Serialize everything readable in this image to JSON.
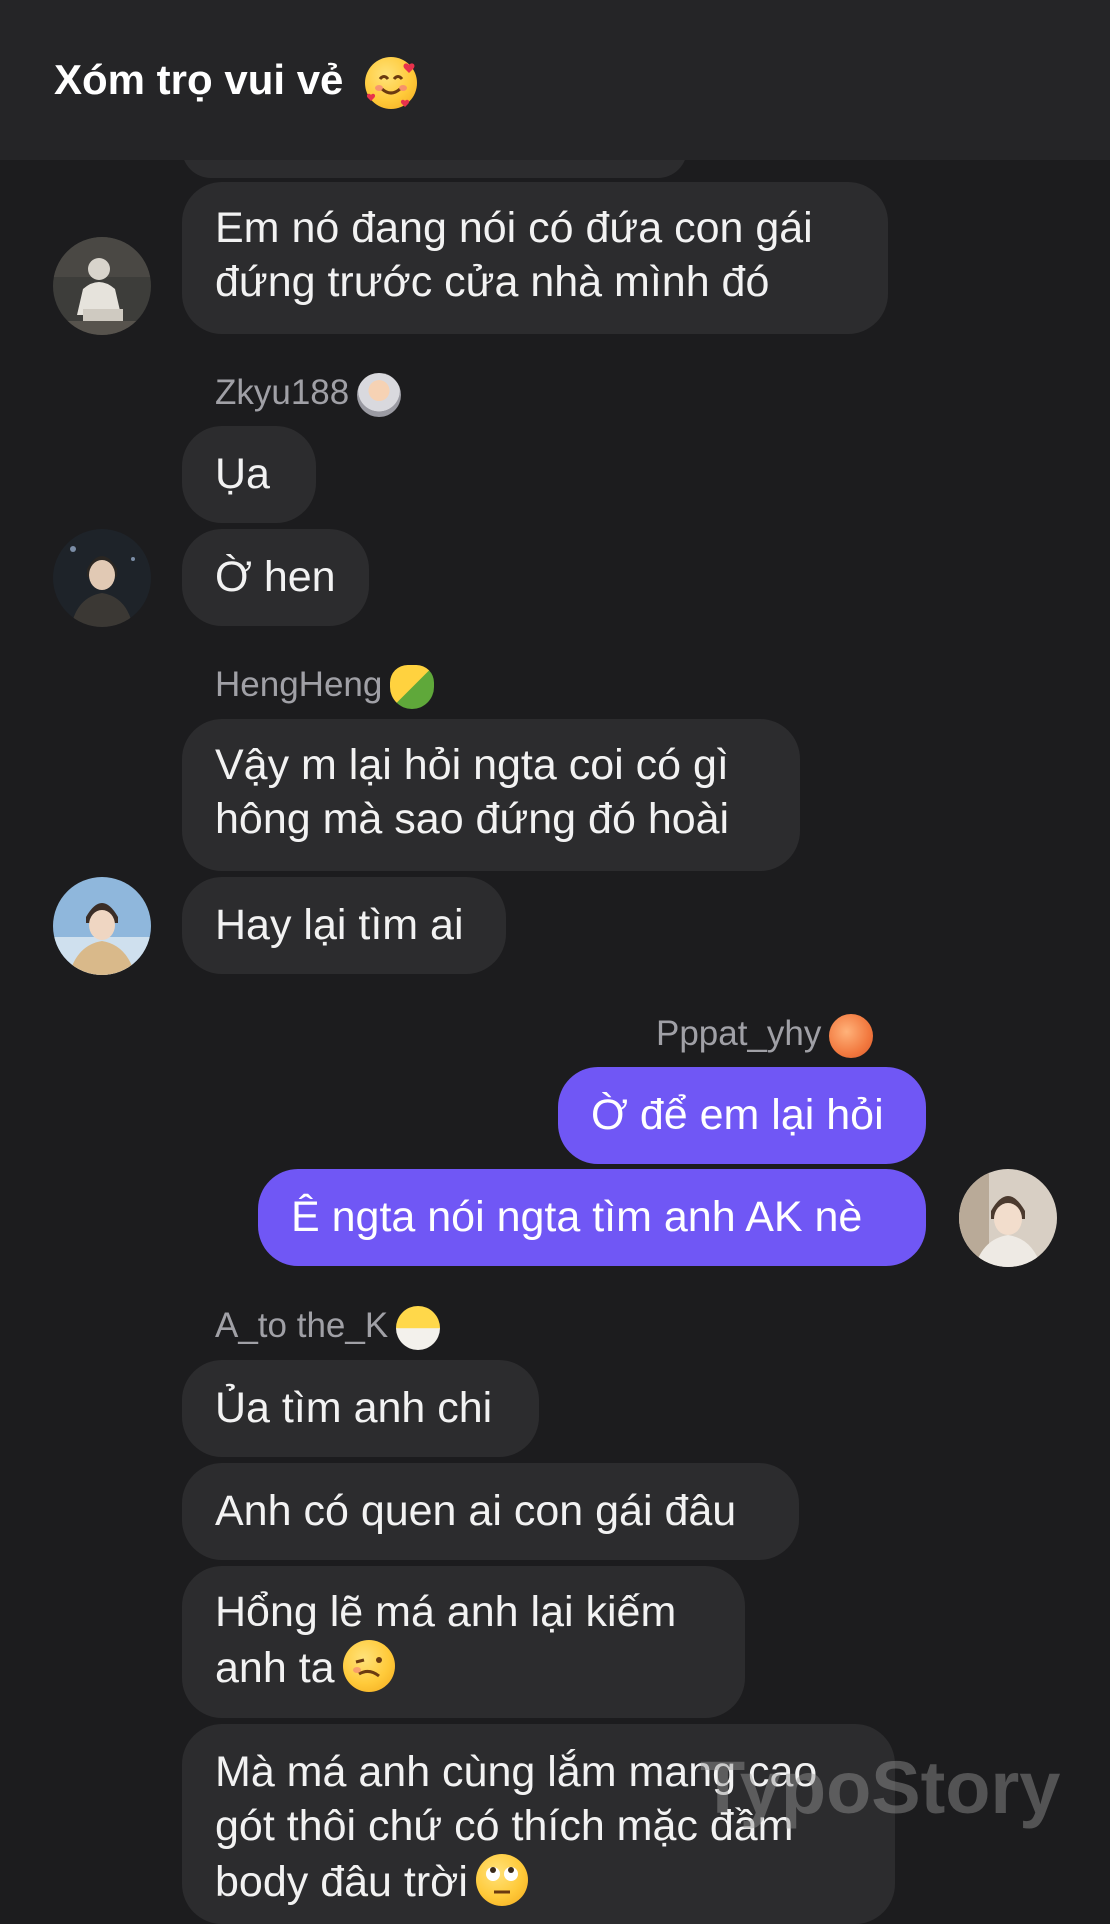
{
  "header": {
    "title": "Xóm trọ vui vẻ",
    "title_emoji": "smiling-face-with-hearts"
  },
  "messages": [
    {
      "text_lines": [
        "Em nó đang nói có đứa con gái",
        "đứng trước cửa nhà mình đó"
      ]
    },
    {
      "sender": "Zkyu188",
      "sender_emoji": "astronaut",
      "text": "Ụa"
    },
    {
      "text": "Ờ hen"
    },
    {
      "sender": "HengHeng",
      "sender_emoji": "corn",
      "text_lines": [
        "Vậy m lại hỏi ngta coi có gì",
        "hông mà sao đứng đó hoài"
      ]
    },
    {
      "text": "Hay lại tìm ai"
    },
    {
      "sender": "Pppat_yhy",
      "sender_emoji": "peach",
      "text": "Ờ để em lại hỏi"
    },
    {
      "text": "Ê ngta nói ngta tìm anh AK nè"
    },
    {
      "sender": "A_to the_K",
      "sender_emoji": "hatching-chick",
      "text": "Ủa tìm anh chi"
    },
    {
      "text": "Anh có quen ai con gái đâu"
    },
    {
      "text_lines": [
        "Hổng lẽ má anh lại kiếm",
        "anh ta"
      ],
      "emoji": "woozy-face"
    },
    {
      "text_lines": [
        "Mà má anh cùng lắm mang cao",
        "gót thôi chứ có thích mặc đầm",
        "body đâu trời"
      ],
      "emoji": "face-with-rolling-eyes"
    }
  ],
  "watermark": "TypoStory",
  "colors": {
    "background": "#1c1c1e",
    "header": "#252527",
    "bubble_incoming": "#2c2c2e",
    "bubble_outgoing": "#7057f5",
    "sender_text": "#a0a0a6"
  }
}
